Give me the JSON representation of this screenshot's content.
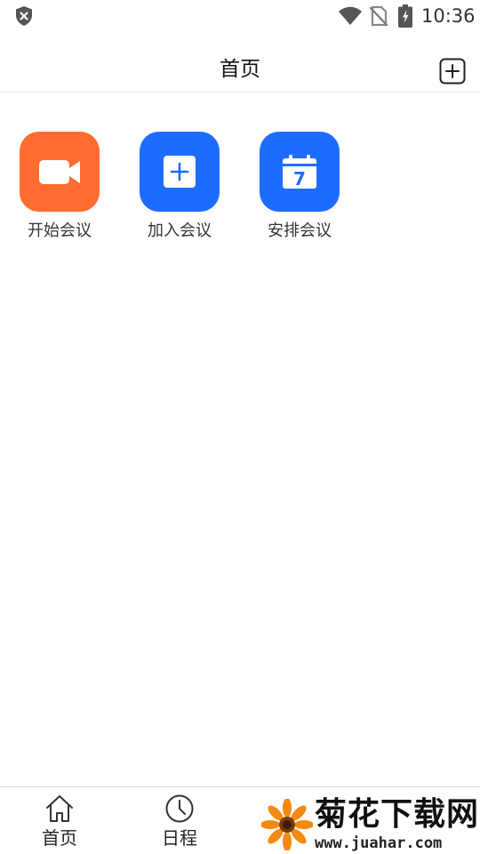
{
  "status_bar": {
    "time": "10:36",
    "icons": [
      "shield-x-icon",
      "wifi-icon",
      "no-sim-icon",
      "battery-charging-icon"
    ]
  },
  "header": {
    "title": "首页",
    "action_icon": "add-square-icon"
  },
  "actions": [
    {
      "label": "开始会议",
      "icon": "video-camera-icon",
      "color": "#ff6c2f"
    },
    {
      "label": "加入会议",
      "icon": "plus-square-icon",
      "color": "#1e6cff"
    },
    {
      "label": "安排会议",
      "icon": "calendar-icon",
      "color": "#1e6cff",
      "icon_text": "7"
    }
  ],
  "tabs": [
    {
      "label": "首页",
      "icon": "home-icon"
    },
    {
      "label": "日程",
      "icon": "clock-icon"
    }
  ],
  "watermark": {
    "title": "菊花下载网",
    "url": "www.juahar.com"
  }
}
